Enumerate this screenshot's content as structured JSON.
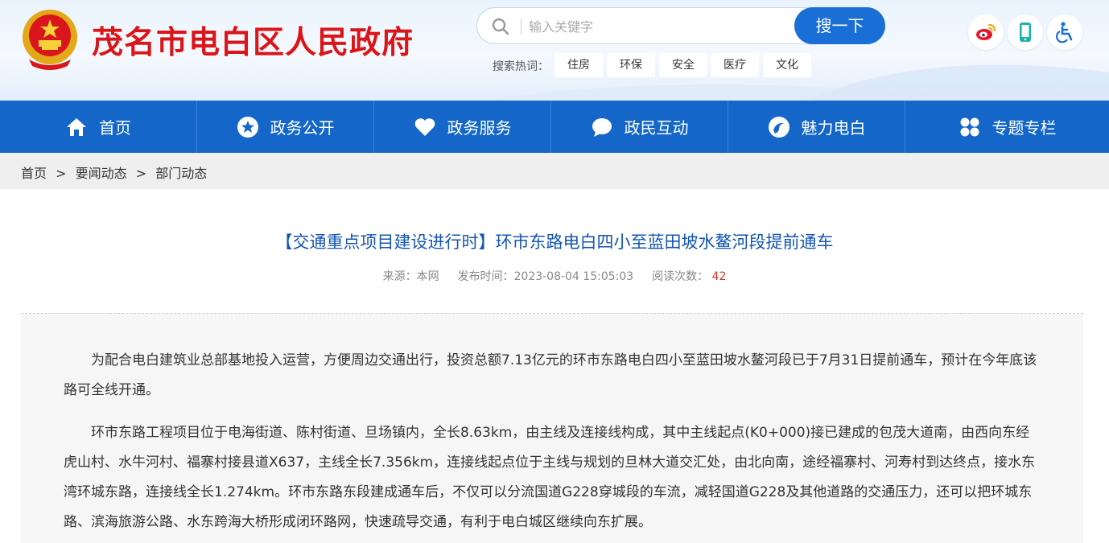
{
  "site": {
    "title": "茂名市电白区人民政府"
  },
  "search": {
    "placeholder": "输入关键字",
    "button_label": "搜一下"
  },
  "hot_search": {
    "label": "搜索热词：",
    "tags": [
      "住房",
      "环保",
      "安全",
      "医疗",
      "文化"
    ]
  },
  "top_icons": [
    "weibo-icon",
    "mobile-icon",
    "accessibility-icon"
  ],
  "nav": {
    "items": [
      {
        "label": "首页",
        "icon": "home-icon"
      },
      {
        "label": "政务公开",
        "icon": "star-icon"
      },
      {
        "label": "政务服务",
        "icon": "heart-icon"
      },
      {
        "label": "政民互动",
        "icon": "chat-icon"
      },
      {
        "label": "魅力电白",
        "icon": "swirl-icon"
      },
      {
        "label": "专题专栏",
        "icon": "grid-icon"
      }
    ]
  },
  "breadcrumb": [
    "首页",
    ">",
    "要闻动态",
    ">",
    "部门动态"
  ],
  "article": {
    "title": "【交通重点项目建设进行时】环市东路电白四小至蓝田坡水鳌河段提前通车",
    "source_label": "来源：",
    "source": "本网",
    "date_label": "发布时间：",
    "date": "2023-08-04 15:05:03",
    "views_label": "阅读次数：",
    "views": "42",
    "paragraphs": [
      "为配合电白建筑业总部基地投入运营，方便周边交通出行，投资总额7.13亿元的环市东路电白四小至蓝田坡水鳌河段已于7月31日提前通车，预计在今年底该路可全线开通。",
      "环市东路工程项目位于电海街道、陈村街道、旦场镇内，全长8.63km，由主线及连接线构成，其中主线起点(K0+000)接已建成的包茂大道南，由西向东经虎山村、水牛河村、福寨村接县道X637，主线全长7.356km，连接线起点位于主线与规划的旦林大道交汇处，由北向南，途经福寨村、河寿村到达终点，接水东湾环城东路，连接线全长1.274km。环市东路东段建成通车后，不仅可以分流国道G228穿城段的车流，减轻国道G228及其他道路的交通压力，还可以把环城东路、滨海旅游公路、水东跨海大桥形成闭环路网，快速疏导交通，有利于电白城区继续向东扩展。"
    ]
  },
  "colors": {
    "brand_red": "#d8161b",
    "nav_blue": "#1467c9",
    "title_blue": "#1356b3",
    "count_red": "#c0392b"
  }
}
